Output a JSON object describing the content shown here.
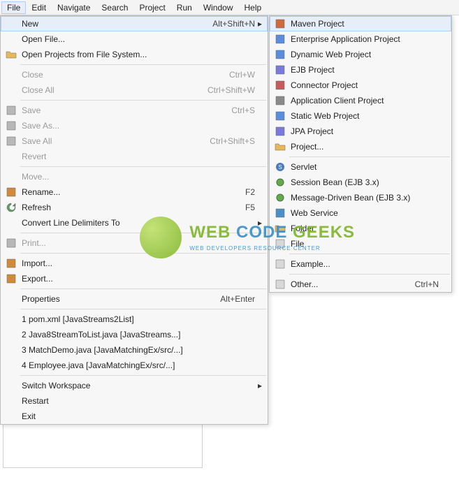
{
  "menubar": [
    "File",
    "Edit",
    "Navigate",
    "Search",
    "Project",
    "Run",
    "Window",
    "Help"
  ],
  "menubar_active": 0,
  "fileMenu": [
    {
      "type": "item",
      "icon": "",
      "label": "New",
      "shortcut": "Alt+Shift+N",
      "submenu": true,
      "highlight": true
    },
    {
      "type": "item",
      "icon": "",
      "label": "Open File..."
    },
    {
      "type": "item",
      "icon": "folder-open",
      "label": "Open Projects from File System..."
    },
    {
      "type": "sep"
    },
    {
      "type": "item",
      "icon": "",
      "label": "Close",
      "shortcut": "Ctrl+W",
      "disabled": true
    },
    {
      "type": "item",
      "icon": "",
      "label": "Close All",
      "shortcut": "Ctrl+Shift+W",
      "disabled": true
    },
    {
      "type": "sep"
    },
    {
      "type": "item",
      "icon": "save",
      "label": "Save",
      "shortcut": "Ctrl+S",
      "disabled": true
    },
    {
      "type": "item",
      "icon": "save-as",
      "label": "Save As...",
      "disabled": true
    },
    {
      "type": "item",
      "icon": "save-all",
      "label": "Save All",
      "shortcut": "Ctrl+Shift+S",
      "disabled": true
    },
    {
      "type": "item",
      "icon": "",
      "label": "Revert",
      "disabled": true
    },
    {
      "type": "sep"
    },
    {
      "type": "item",
      "icon": "",
      "label": "Move...",
      "disabled": true
    },
    {
      "type": "item",
      "icon": "rename",
      "label": "Rename...",
      "shortcut": "F2"
    },
    {
      "type": "item",
      "icon": "refresh",
      "label": "Refresh",
      "shortcut": "F5"
    },
    {
      "type": "item",
      "icon": "",
      "label": "Convert Line Delimiters To",
      "submenu": true
    },
    {
      "type": "sep"
    },
    {
      "type": "item",
      "icon": "print",
      "label": "Print...",
      "disabled": true
    },
    {
      "type": "sep"
    },
    {
      "type": "item",
      "icon": "import",
      "label": "Import..."
    },
    {
      "type": "item",
      "icon": "export",
      "label": "Export..."
    },
    {
      "type": "sep"
    },
    {
      "type": "item",
      "icon": "",
      "label": "Properties",
      "shortcut": "Alt+Enter"
    },
    {
      "type": "sep"
    },
    {
      "type": "item",
      "icon": "",
      "label": "1 pom.xml  [JavaStreams2List]"
    },
    {
      "type": "item",
      "icon": "",
      "label": "2 Java8StreamToList.java  [JavaStreams...]"
    },
    {
      "type": "item",
      "icon": "",
      "label": "3 MatchDemo.java  [JavaMatchingEx/src/...]"
    },
    {
      "type": "item",
      "icon": "",
      "label": "4 Employee.java  [JavaMatchingEx/src/...]"
    },
    {
      "type": "sep"
    },
    {
      "type": "item",
      "icon": "",
      "label": "Switch Workspace",
      "submenu": true
    },
    {
      "type": "item",
      "icon": "",
      "label": "Restart"
    },
    {
      "type": "item",
      "icon": "",
      "label": "Exit"
    }
  ],
  "newMenu": [
    {
      "type": "item",
      "icon": "maven",
      "label": "Maven Project",
      "highlight": true
    },
    {
      "type": "item",
      "icon": "ear",
      "label": "Enterprise Application Project"
    },
    {
      "type": "item",
      "icon": "web",
      "label": "Dynamic Web Project"
    },
    {
      "type": "item",
      "icon": "ejb",
      "label": "EJB Project"
    },
    {
      "type": "item",
      "icon": "connector",
      "label": "Connector Project"
    },
    {
      "type": "item",
      "icon": "appclient",
      "label": "Application Client Project"
    },
    {
      "type": "item",
      "icon": "staticweb",
      "label": "Static Web Project"
    },
    {
      "type": "item",
      "icon": "jpa",
      "label": "JPA Project"
    },
    {
      "type": "item",
      "icon": "project",
      "label": "Project..."
    },
    {
      "type": "sep"
    },
    {
      "type": "item",
      "icon": "servlet",
      "label": "Servlet"
    },
    {
      "type": "item",
      "icon": "bean",
      "label": "Session Bean (EJB 3.x)"
    },
    {
      "type": "item",
      "icon": "bean",
      "label": "Message-Driven Bean (EJB 3.x)"
    },
    {
      "type": "item",
      "icon": "ws",
      "label": "Web Service"
    },
    {
      "type": "item",
      "icon": "folder",
      "label": "Folder"
    },
    {
      "type": "item",
      "icon": "file",
      "label": "File"
    },
    {
      "type": "sep"
    },
    {
      "type": "item",
      "icon": "example",
      "label": "Example..."
    },
    {
      "type": "sep"
    },
    {
      "type": "item",
      "icon": "other",
      "label": "Other...",
      "shortcut": "Ctrl+N"
    }
  ],
  "watermark": {
    "line1_a": "WEB",
    "line1_b": "CODE",
    "line1_c": "GEEKS",
    "line2": "WEB DEVELOPERS RESOURCE CENTER"
  }
}
